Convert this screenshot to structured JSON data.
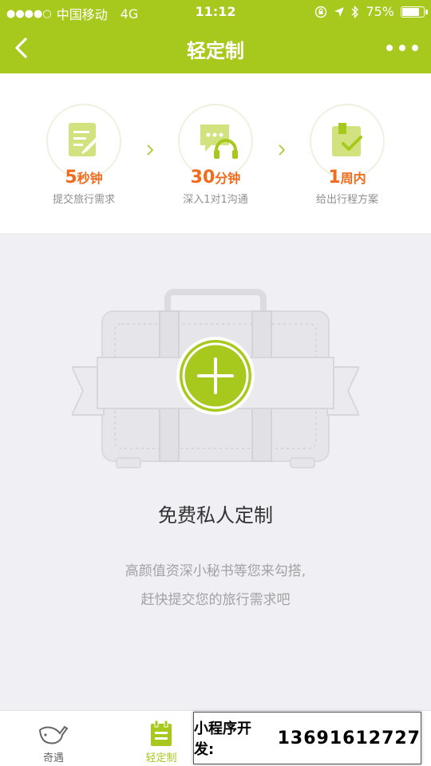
{
  "status_bar": {
    "signal_dots": "●●●●○",
    "carrier": "中国移动",
    "network": "4G",
    "time": "11:12",
    "battery_percent": "75%",
    "battery_level": 0.75
  },
  "navbar": {
    "title": "轻定制",
    "back_icon": "chevron-left-icon",
    "more_icon": "more-dots-icon"
  },
  "steps": [
    {
      "value": "5",
      "unit": "秒钟",
      "desc": "提交旅行需求",
      "icon": "edit-document-icon"
    },
    {
      "value": "30",
      "unit": "分钟",
      "desc": "深入1对1沟通",
      "icon": "chat-headphones-icon"
    },
    {
      "value": "1",
      "unit": "周内",
      "desc": "给出行程方案",
      "icon": "plan-check-icon"
    }
  ],
  "main": {
    "title": "免费私人定制",
    "subtitle_line1": "高颜值资深小秘书等您来勾搭,",
    "subtitle_line2": "赶快提交您的旅行需求吧"
  },
  "tabbar": {
    "tabs": [
      {
        "label": "奇遇",
        "icon": "whale-icon",
        "active": false
      },
      {
        "label": "轻定制",
        "icon": "calendar-icon",
        "active": true
      }
    ]
  },
  "promo": {
    "label": "小程序开发:",
    "phone": "13691612727"
  },
  "colors": {
    "brand": "#a7c91d",
    "accent_orange": "#f06b1c",
    "background": "#efeff4"
  }
}
